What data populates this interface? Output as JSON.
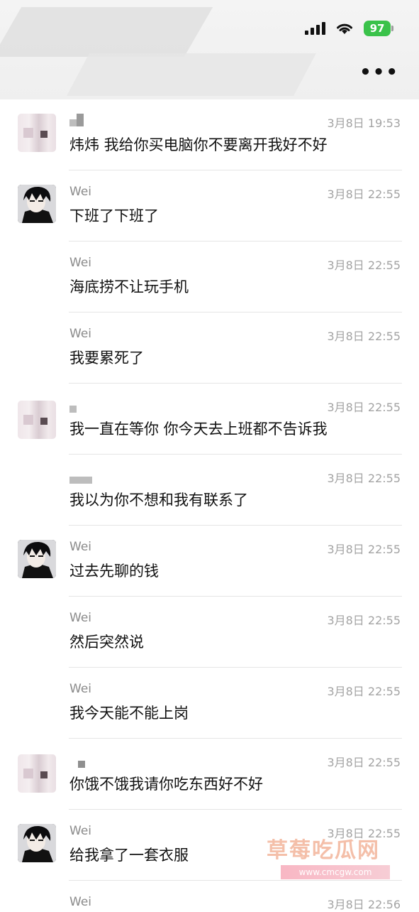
{
  "status_bar": {
    "battery": "97"
  },
  "header": {
    "more_icon": "more-icon"
  },
  "messages": [
    {
      "sender": "",
      "time": "3月8日 19:53",
      "text": "炜炜 我给你买电脑你不要离开我好不好",
      "avatar": "blurred"
    },
    {
      "sender": "Wei",
      "time": "3月8日 22:55",
      "text": "下班了下班了",
      "avatar": "anime"
    },
    {
      "sender": "Wei",
      "time": "3月8日 22:55",
      "text": "海底捞不让玩手机",
      "avatar": ""
    },
    {
      "sender": "Wei",
      "time": "3月8日 22:55",
      "text": "我要累死了",
      "avatar": ""
    },
    {
      "sender": "",
      "time": "3月8日 22:55",
      "text": "我一直在等你 你今天去上班都不告诉我",
      "avatar": "blurred"
    },
    {
      "sender": "",
      "time": "3月8日 22:55",
      "text": "我以为你不想和我有联系了",
      "avatar": ""
    },
    {
      "sender": "Wei",
      "time": "3月8日 22:55",
      "text": "过去先聊的钱",
      "avatar": "anime"
    },
    {
      "sender": "Wei",
      "time": "3月8日 22:55",
      "text": "然后突然说",
      "avatar": ""
    },
    {
      "sender": "Wei",
      "time": "3月8日 22:55",
      "text": "我今天能不能上岗",
      "avatar": ""
    },
    {
      "sender": "",
      "time": "3月8日 22:55",
      "text": "你饿不饿我请你吃东西好不好",
      "avatar": "blurred"
    },
    {
      "sender": "Wei",
      "time": "3月8日 22:55",
      "text": "给我拿了一套衣服",
      "avatar": "anime"
    },
    {
      "sender": "Wei",
      "time": "3月8日 22:56",
      "text": "",
      "avatar": ""
    }
  ],
  "watermark": {
    "text": "草莓吃瓜网",
    "url": "www.cmcgw.com"
  }
}
